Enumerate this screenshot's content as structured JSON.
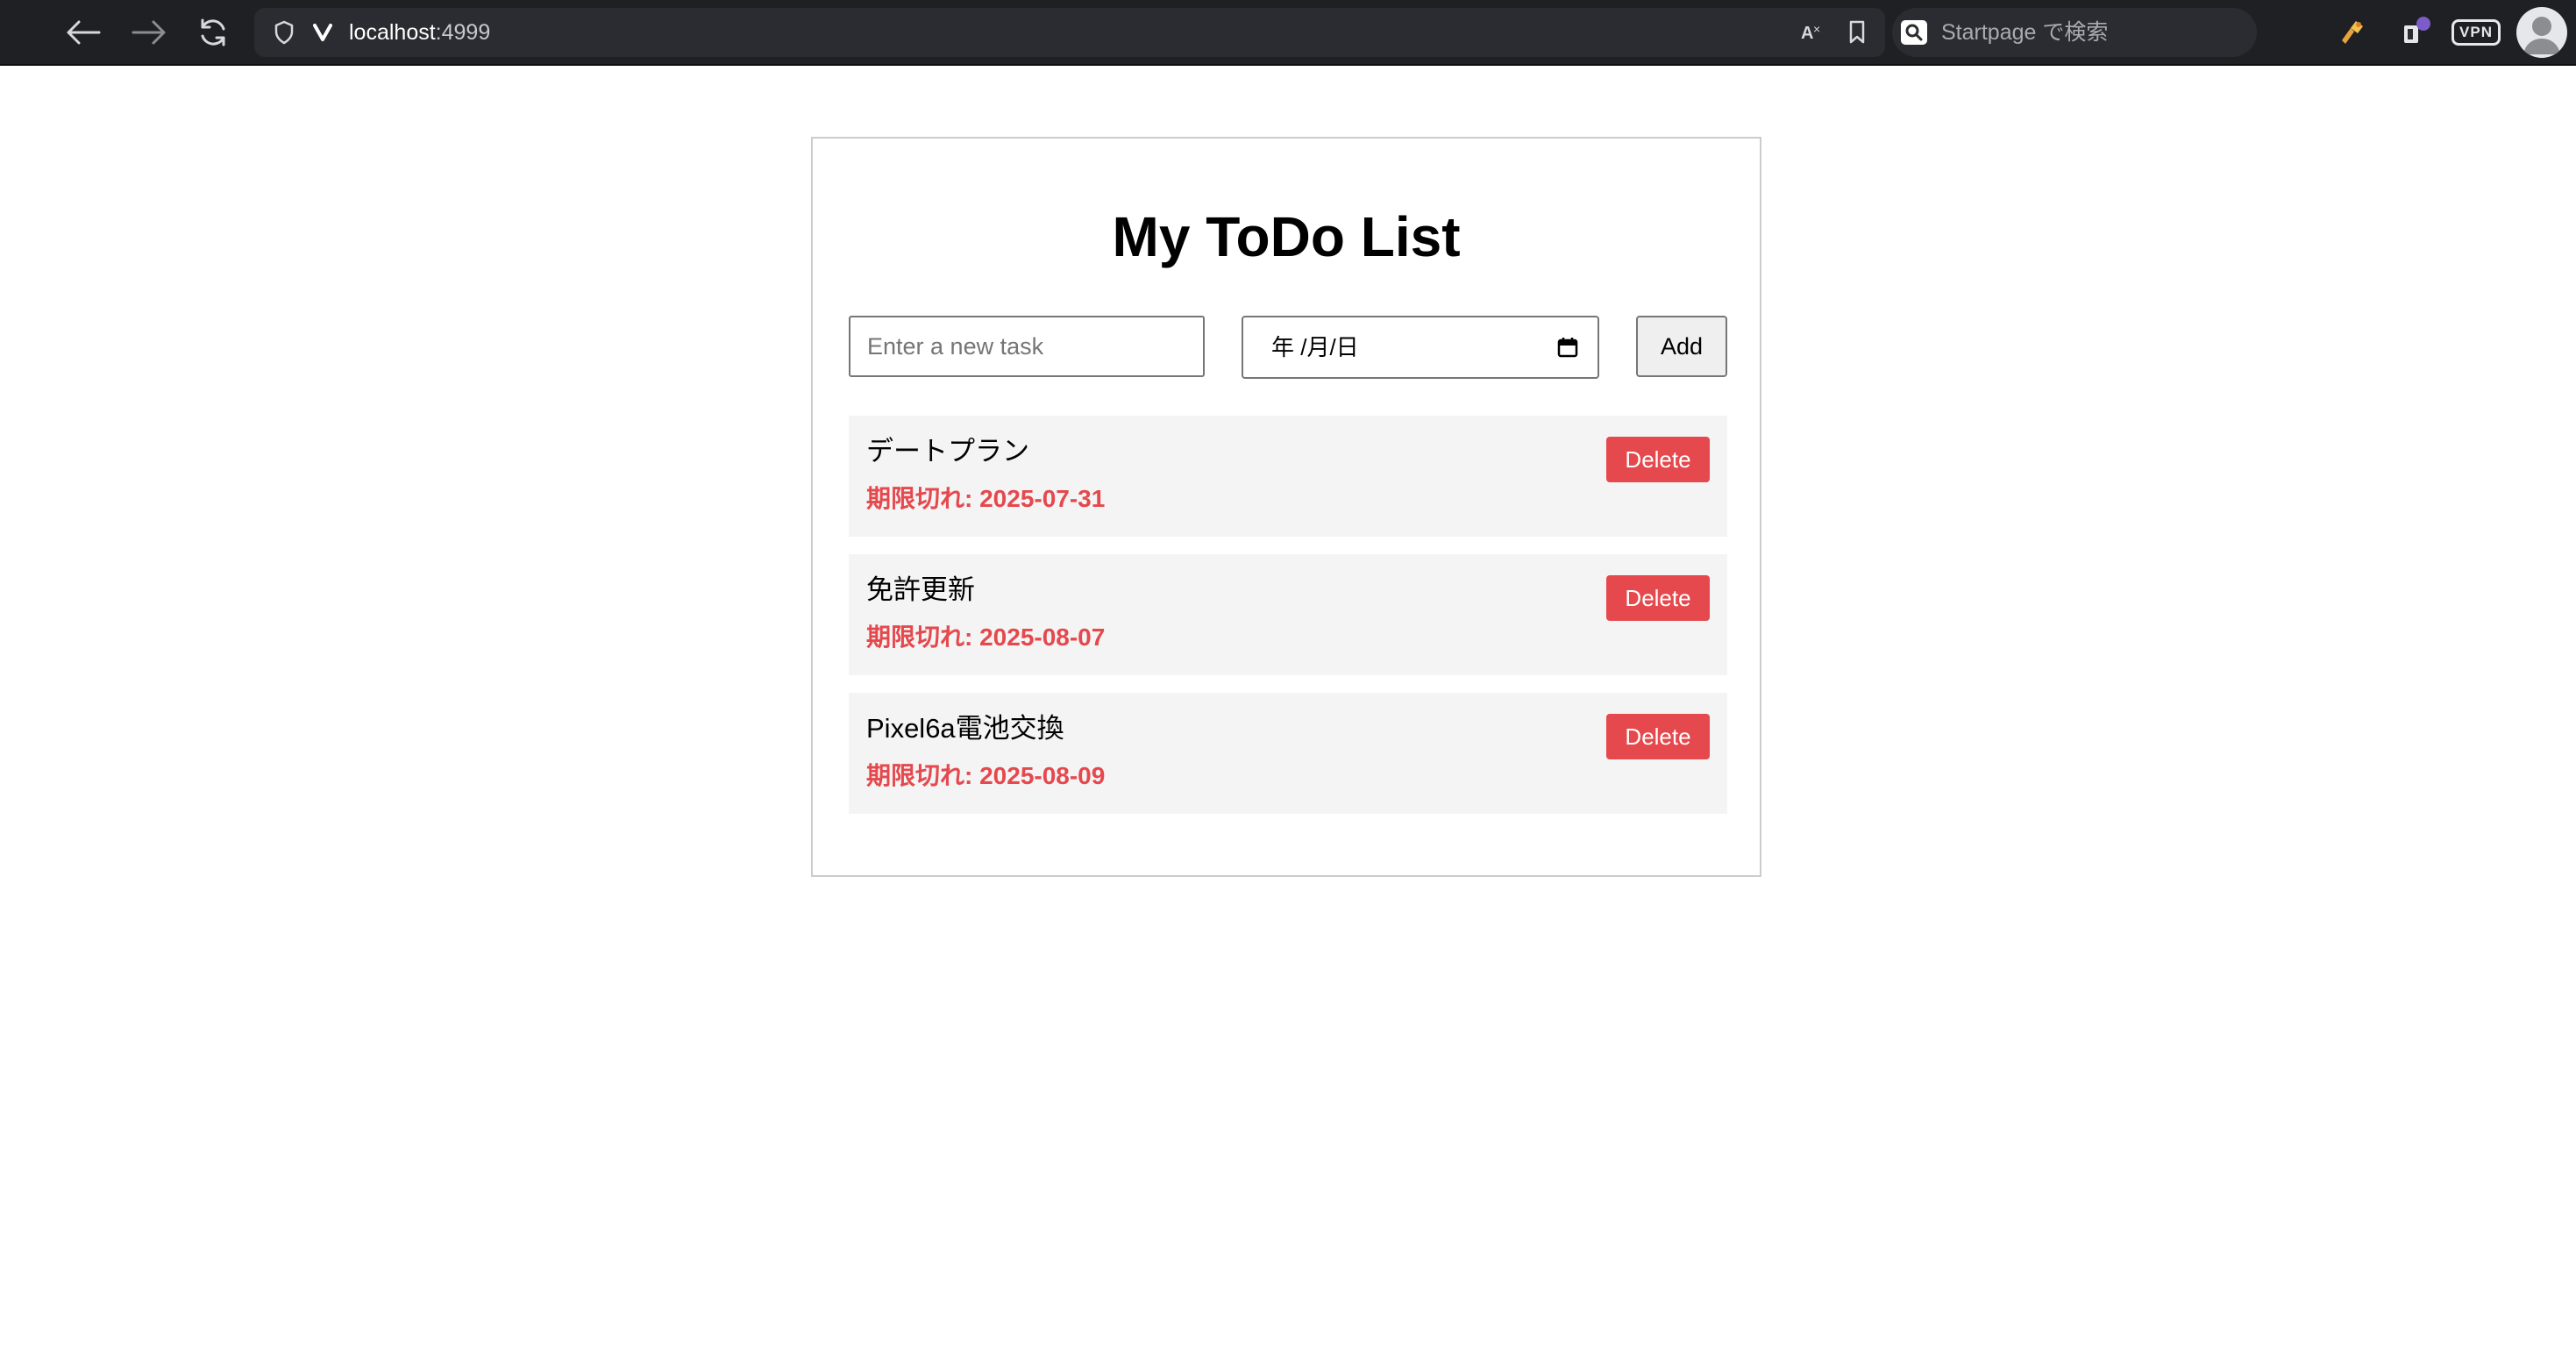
{
  "browser": {
    "url_host": "localhost",
    "url_port": ":4999",
    "search_placeholder": "Startpage で検索",
    "vpn_label": "VPN"
  },
  "page": {
    "title": "My ToDo List",
    "task_placeholder": "Enter a new task",
    "date_placeholder": "年 /月/日",
    "add_label": "Add",
    "delete_label": "Delete"
  },
  "todos": [
    {
      "text": "デートプラン",
      "due": "期限切れ: 2025-07-31"
    },
    {
      "text": "免許更新",
      "due": "期限切れ: 2025-08-07"
    },
    {
      "text": "Pixel6a電池交換",
      "due": "期限切れ: 2025-08-09"
    }
  ],
  "colors": {
    "overdue": "#e5484d",
    "delete_button": "#e5484d",
    "item_background": "#f4f4f4",
    "toolbar": "#1f2024"
  },
  "icons": [
    "back-arrow-icon",
    "forward-arrow-icon",
    "reload-icon",
    "shield-icon",
    "vivaldi-logo-icon",
    "translate-icon",
    "bookmark-icon",
    "search-engine-icon",
    "extension-icon",
    "wallet-icon",
    "vpn-icon",
    "avatar",
    "calendar-icon"
  ]
}
